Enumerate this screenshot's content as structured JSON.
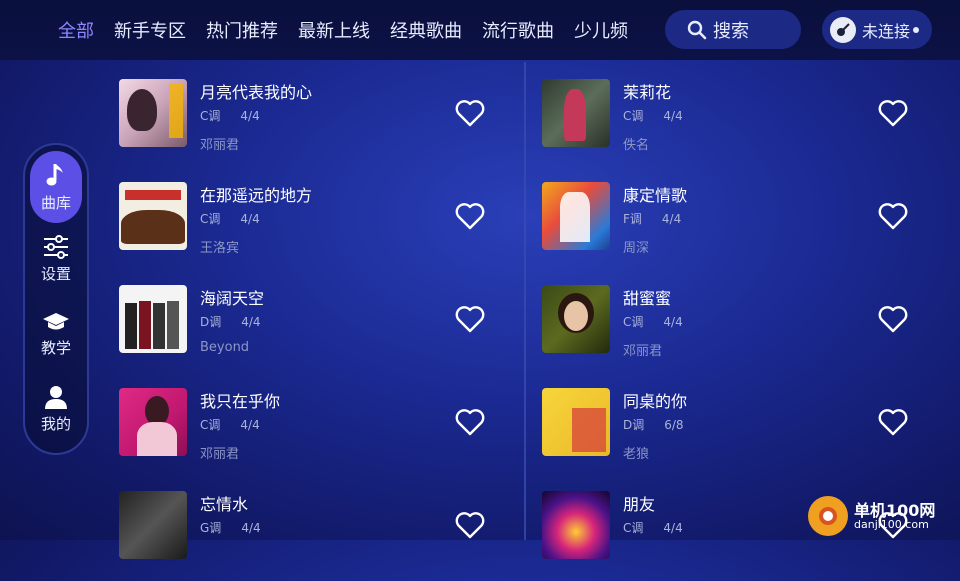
{
  "tabs": [
    "全部",
    "新手专区",
    "热门推荐",
    "最新上线",
    "经典歌曲",
    "流行歌曲",
    "少儿频"
  ],
  "search": {
    "label": "搜索"
  },
  "connection": {
    "label": "未连接"
  },
  "nav": [
    {
      "label": "曲库",
      "icon": "music-note-icon"
    },
    {
      "label": "设置",
      "icon": "sliders-icon"
    },
    {
      "label": "教学",
      "icon": "graduation-cap-icon"
    },
    {
      "label": "我的",
      "icon": "user-icon"
    }
  ],
  "songs_left": [
    {
      "title": "月亮代表我的心",
      "key": "C调",
      "beat": "4/4",
      "artist": "邓丽君"
    },
    {
      "title": "在那遥远的地方",
      "key": "C调",
      "beat": "4/4",
      "artist": "王洛宾"
    },
    {
      "title": "海阔天空",
      "key": "D调",
      "beat": "4/4",
      "artist": "Beyond"
    },
    {
      "title": "我只在乎你",
      "key": "C调",
      "beat": "4/4",
      "artist": "邓丽君"
    },
    {
      "title": "忘情水",
      "key": "G调",
      "beat": "4/4",
      "artist": ""
    }
  ],
  "songs_right": [
    {
      "title": "茉莉花",
      "key": "C调",
      "beat": "4/4",
      "artist": "佚名"
    },
    {
      "title": "康定情歌",
      "key": "F调",
      "beat": "4/4",
      "artist": "周深"
    },
    {
      "title": "甜蜜蜜",
      "key": "C调",
      "beat": "4/4",
      "artist": "邓丽君"
    },
    {
      "title": "同桌的你",
      "key": "D调",
      "beat": "6/8",
      "artist": "老狼"
    },
    {
      "title": "朋友",
      "key": "C调",
      "beat": "4/4",
      "artist": ""
    }
  ],
  "watermark": {
    "name": "单机100网",
    "url": "danji100.com"
  },
  "colors": {
    "accent": "#8f86ff",
    "nav_active": "#5b4fe6",
    "background": "#1b2a93"
  }
}
